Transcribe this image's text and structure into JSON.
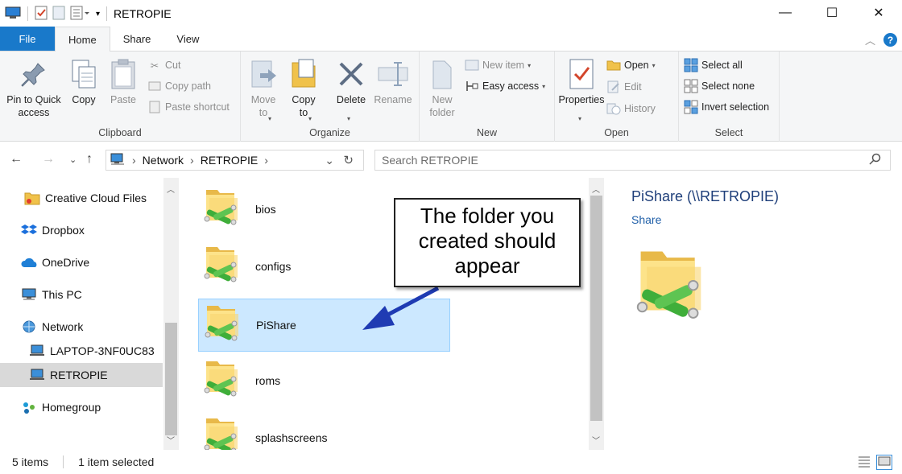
{
  "window": {
    "title": "RETROPIE",
    "minimize": "—",
    "maximize": "☐",
    "close": "✕"
  },
  "tabs": [
    {
      "label": "File"
    },
    {
      "label": "Home"
    },
    {
      "label": "Share"
    },
    {
      "label": "View"
    }
  ],
  "ribbon": {
    "clipboard": {
      "label": "Clipboard",
      "pin": "Pin to Quick\naccess",
      "copy": "Copy",
      "paste": "Paste",
      "cut": "Cut",
      "copy_path": "Copy path",
      "paste_shortcut": "Paste shortcut"
    },
    "organize": {
      "label": "Organize",
      "move_to": "Move\nto",
      "copy_to": "Copy\nto",
      "delete": "Delete",
      "rename": "Rename"
    },
    "new": {
      "label": "New",
      "new_folder": "New\nfolder",
      "new_item": "New item",
      "easy_access": "Easy access"
    },
    "open": {
      "label": "Open",
      "properties": "Properties",
      "open": "Open",
      "edit": "Edit",
      "history": "History"
    },
    "select": {
      "label": "Select",
      "select_all": "Select all",
      "select_none": "Select none",
      "invert_selection": "Invert selection"
    }
  },
  "address": {
    "crumbs": [
      "Network",
      "RETROPIE"
    ],
    "search_placeholder": "Search RETROPIE"
  },
  "nav": {
    "items": [
      {
        "label": "Creative Cloud Files",
        "icon": "creative-cloud-icon"
      },
      {
        "label": "Dropbox",
        "icon": "dropbox-icon"
      },
      {
        "label": "OneDrive",
        "icon": "onedrive-icon"
      },
      {
        "label": "This PC",
        "icon": "this-pc-icon"
      },
      {
        "label": "Network",
        "icon": "network-icon"
      },
      {
        "label": "LAPTOP-3NF0UC83",
        "icon": "computer-icon"
      },
      {
        "label": "RETROPIE",
        "icon": "computer-icon"
      },
      {
        "label": "Homegroup",
        "icon": "homegroup-icon"
      }
    ]
  },
  "files": [
    {
      "name": "bios"
    },
    {
      "name": "configs"
    },
    {
      "name": "PiShare"
    },
    {
      "name": "roms"
    },
    {
      "name": "splashscreens"
    }
  ],
  "callout": {
    "text": "The folder you created should appear"
  },
  "details": {
    "title": "PiShare (\\\\RETROPIE)",
    "subtitle": "Share"
  },
  "status": {
    "count": "5 items",
    "selected": "1 item selected"
  },
  "colors": {
    "accent": "#1979ca",
    "selection": "#cce8ff",
    "arrow": "#1f3bb3"
  }
}
